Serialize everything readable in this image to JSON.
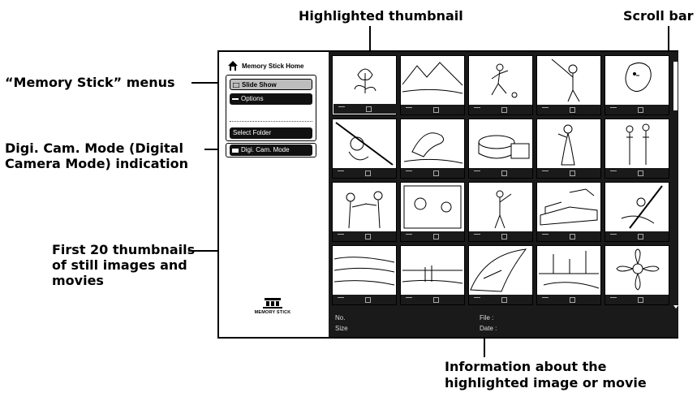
{
  "callouts": {
    "highlighted_thumbnail": "Highlighted thumbnail",
    "scroll_bar": "Scroll bar",
    "memory_stick_menus": "“Memory Stick” menus",
    "digi_cam_line1": "Digi. Cam. Mode (Digital",
    "digi_cam_line2": "Camera Mode) indication",
    "first_20_line1": "First 20 thumbnails",
    "first_20_line2": "of still images and",
    "first_20_line3": "movies",
    "info_line1": "Information about the",
    "info_line2": "highlighted image or movie"
  },
  "screen": {
    "home_label": "Memory Stick Home",
    "menu": {
      "slide_show": "Slide Show",
      "options": "Options",
      "select_folder": "Select Folder"
    },
    "digi_cam_mode": "Digi. Cam. Mode",
    "logo_text": "MEMORY STICK",
    "info": {
      "no_label": "No.",
      "size_label": "Size",
      "file_label": "File :",
      "date_label": "Date :"
    },
    "thumbnails": [
      {
        "subject": "tulip",
        "highlighted": true
      },
      {
        "subject": "mountain lake"
      },
      {
        "subject": "soccer player"
      },
      {
        "subject": "baseball batter"
      },
      {
        "subject": "dog"
      },
      {
        "subject": "baseball pitcher"
      },
      {
        "subject": "dolphin"
      },
      {
        "subject": "stadium"
      },
      {
        "subject": "singer"
      },
      {
        "subject": "couple"
      },
      {
        "subject": "boxers"
      },
      {
        "subject": "people at window"
      },
      {
        "subject": "golfer"
      },
      {
        "subject": "train"
      },
      {
        "subject": "hikers"
      },
      {
        "subject": "beach"
      },
      {
        "subject": "couple on beach"
      },
      {
        "subject": "surfer wave"
      },
      {
        "subject": "city skyline"
      },
      {
        "subject": "flower"
      }
    ]
  }
}
